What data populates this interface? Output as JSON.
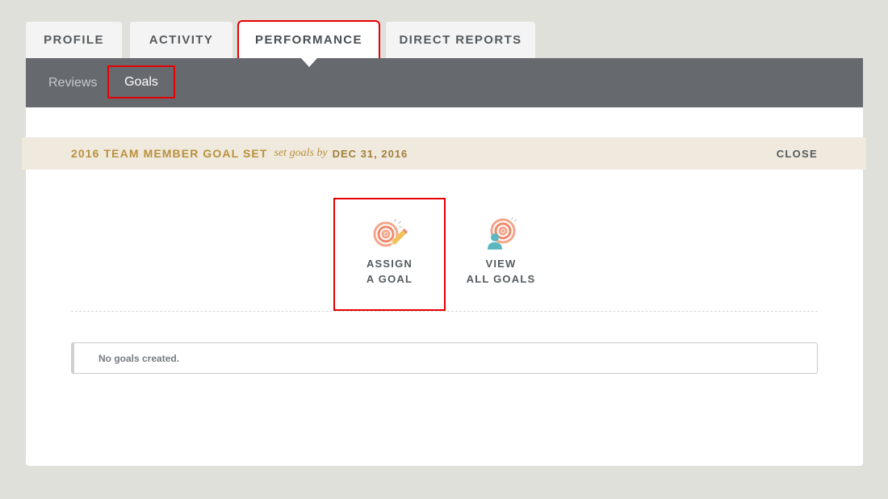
{
  "tabs": [
    {
      "label": "PROFILE"
    },
    {
      "label": "ACTIVITY"
    },
    {
      "label": "PERFORMANCE"
    },
    {
      "label": "DIRECT REPORTS"
    }
  ],
  "subnav": {
    "items": [
      {
        "label": "Reviews"
      },
      {
        "label": "Goals"
      }
    ]
  },
  "banner": {
    "title": "2016 TEAM MEMBER GOAL SET",
    "set_goals_by": "set goals by",
    "date": "DEC 31, 2016",
    "close_label": "CLOSE"
  },
  "actions": {
    "assign": {
      "line1": "ASSIGN",
      "line2": "A GOAL",
      "icon": "target-pencil-icon"
    },
    "view": {
      "line1": "VIEW",
      "line2": "ALL GOALS",
      "icon": "target-person-icon"
    }
  },
  "empty_message": "No goals created.",
  "colors": {
    "background": "#e0e0da",
    "subnav": "#666a6e",
    "banner_bg": "#f0eade",
    "banner_text": "#b8903c",
    "highlight": "#e60000",
    "target": "#f0896a",
    "person": "#5bb8c0"
  }
}
